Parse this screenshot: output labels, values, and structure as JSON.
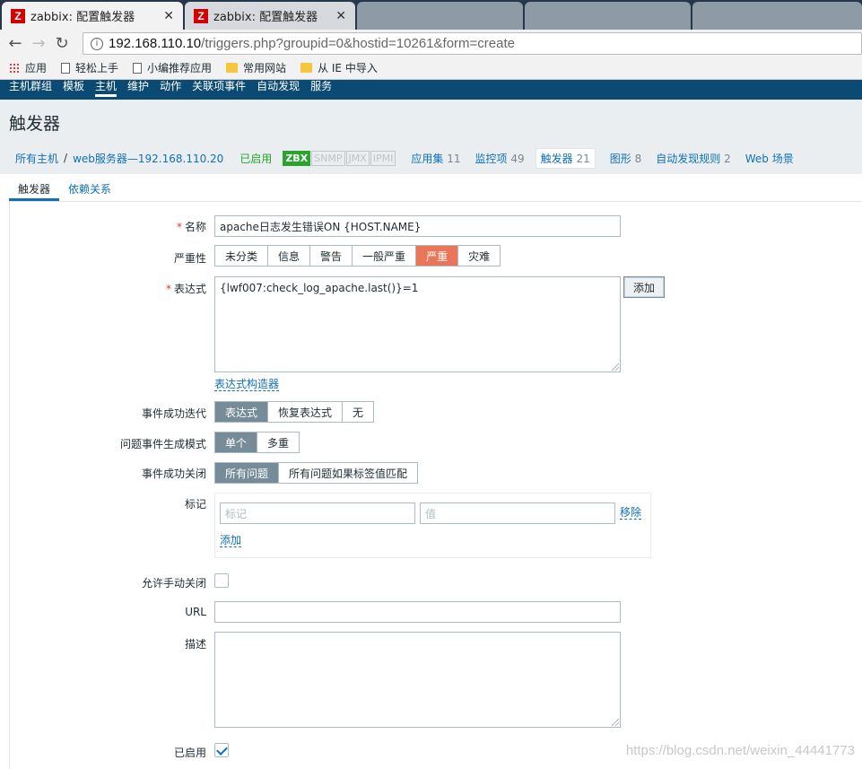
{
  "browser": {
    "tabs": [
      {
        "title": "zabbix: 配置触发器",
        "active": true
      },
      {
        "title": "zabbix: 配置触发器",
        "active": false
      }
    ],
    "url_host": "192.168.110.10",
    "url_path": "/triggers.php?groupid=0&hostid=10261&form=create",
    "bookmarks": [
      "应用",
      "轻松上手",
      "小编推荐应用",
      "常用网站",
      "从 IE 中导入"
    ]
  },
  "topnav": [
    "主机群组",
    "模板",
    "主机",
    "维护",
    "动作",
    "关联项事件",
    "自动发现",
    "服务"
  ],
  "page_title": "触发器",
  "hostbar": {
    "all_hosts": "所有主机",
    "separator": "/",
    "host": "web服务器—192.168.110.20",
    "status": "已启用",
    "badges": [
      "ZBX",
      "SNMP",
      "JMX",
      "IPMI"
    ],
    "links": [
      {
        "label": "应用集",
        "count": "11"
      },
      {
        "label": "监控项",
        "count": "49"
      },
      {
        "label": "触发器",
        "count": "21"
      },
      {
        "label": "图形",
        "count": "8"
      },
      {
        "label": "自动发现规则",
        "count": "2"
      },
      {
        "label": "Web 场景",
        "count": ""
      }
    ]
  },
  "subtabs": [
    "触发器",
    "依赖关系"
  ],
  "form": {
    "name_label": "名称",
    "name_value": "apache日志发生错误ON {HOST.NAME}",
    "severity_label": "严重性",
    "severity_options": [
      "未分类",
      "信息",
      "警告",
      "一般严重",
      "严重",
      "灾难"
    ],
    "severity_selected": "严重",
    "expression_label": "表达式",
    "expression_value": "{lwf007:check_log_apache.last()}=1",
    "add_button": "添加",
    "expression_builder": "表达式构造器",
    "ok_event_gen_label": "事件成功迭代",
    "ok_event_gen_options": [
      "表达式",
      "恢复表达式",
      "无"
    ],
    "problem_mode_label": "问题事件生成模式",
    "problem_mode_options": [
      "单个",
      "多重"
    ],
    "ok_close_label": "事件成功关闭",
    "ok_close_options": [
      "所有问题",
      "所有问题如果标签值匹配"
    ],
    "tags_label": "标记",
    "tag_placeholder": "标记",
    "value_placeholder": "值",
    "remove_link": "移除",
    "add_link": "添加",
    "manual_close_label": "允许手动关闭",
    "manual_close_checked": false,
    "url_label": "URL",
    "url_value": "",
    "description_label": "描述",
    "description_value": "",
    "enabled_label": "已启用",
    "enabled_checked": true
  },
  "watermark": "https://blog.csdn.net/weixin_44441773",
  "colors": {
    "nav": "#0b4a72",
    "link": "#0f70b7",
    "severity_high": "#e97659",
    "selected": "#768d99",
    "enabled": "#29a32e"
  }
}
